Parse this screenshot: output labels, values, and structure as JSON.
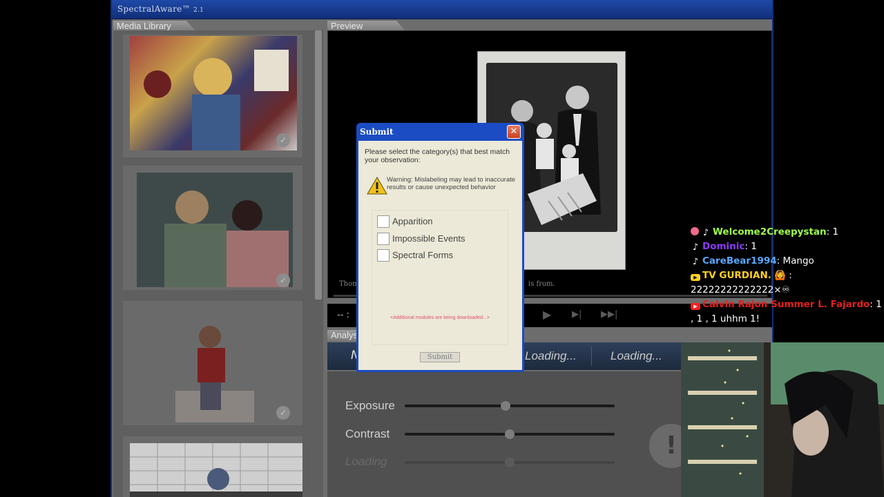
{
  "app": {
    "title": "SpectralAware™",
    "version": "2.1"
  },
  "library": {
    "tab_label": "Media Library"
  },
  "preview": {
    "tab_label": "Preview",
    "caption_left": "Thom",
    "caption_right": "is from.",
    "time": "-- :"
  },
  "analysis": {
    "tab_label": "Analys",
    "first_cell": "N",
    "loading_1": "Loading...",
    "loading_2": "Loading..."
  },
  "adjust": {
    "exposure_label": "Exposure",
    "exposure_value": 0.48,
    "contrast_label": "Contrast",
    "contrast_value": 0.5,
    "loading_label": "Loading",
    "loading_value": 0.5
  },
  "dialog": {
    "title": "Submit",
    "prompt": "Please select the category(s) that best match your observation:",
    "warning": "Warning: Mislabeling may lead to inaccurate results or cause unexpected behavior",
    "options": [
      "Apparition",
      "Impossible Events",
      "Spectral Forms"
    ],
    "modules_note": "<Additional modules are being downloaded...>",
    "submit_label": "Submit"
  },
  "chat": [
    {
      "user": "Welcome2Creepystan",
      "user_color": "#9eff4a",
      "message": ": 1"
    },
    {
      "user": "Dominic",
      "user_color": "#8a3cff",
      "message": ": 1"
    },
    {
      "user": "CareBear1994",
      "user_color": "#5aa8ff",
      "message": ": Mango"
    },
    {
      "user": "TV GURDIAN.",
      "user_color": "#ffd21e",
      "message": " 🙆 : 22222222222222×♾"
    },
    {
      "user": "Calvin Rajon Summer L. Fajardo",
      "user_color": "#e0201e",
      "message": ": 1 , 1 , 1 uhhm 1!"
    }
  ],
  "colors": {
    "titlebar": "#1f4aa8",
    "dialog_frame": "#1b4cc4",
    "dialog_body": "#ece9d8",
    "close": "#c8401f",
    "warning_note": "#e0506a"
  }
}
